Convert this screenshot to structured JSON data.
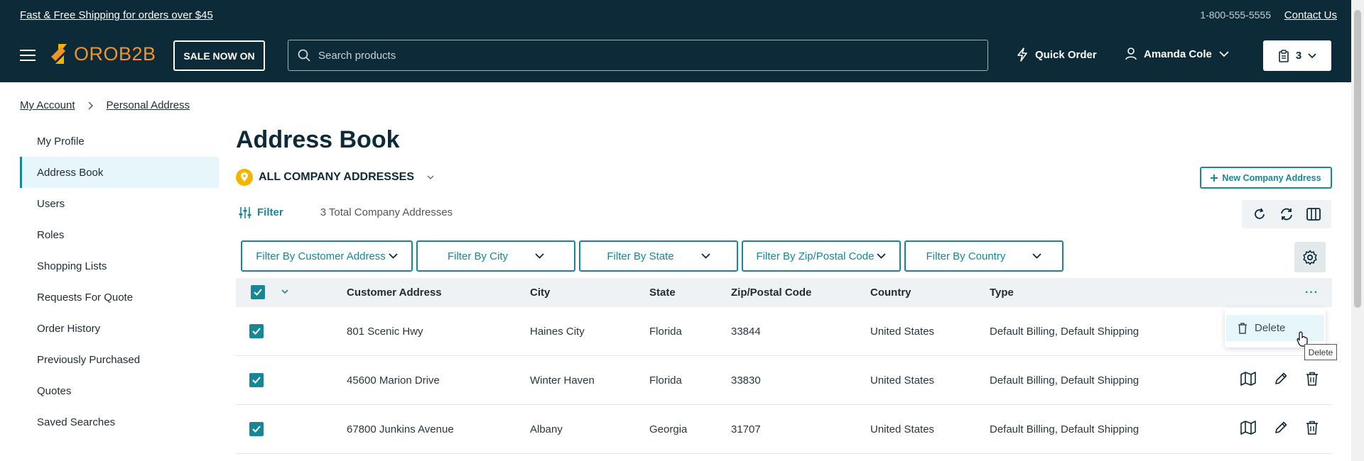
{
  "topbar": {
    "promo": "Fast & Free Shipping for orders over $45",
    "phone": "1-800-555-5555",
    "contact": "Contact Us"
  },
  "header": {
    "logo": "OROB2B",
    "sale_label": "SALE NOW ON",
    "search_placeholder": "Search products",
    "quick_order": "Quick Order",
    "user_name": "Amanda Cole",
    "cart_count": "3"
  },
  "breadcrumb": [
    "My Account",
    "Personal Address"
  ],
  "sidebar": {
    "items": [
      {
        "label": "My Profile"
      },
      {
        "label": "Address Book"
      },
      {
        "label": "Users"
      },
      {
        "label": "Roles"
      },
      {
        "label": "Shopping Lists"
      },
      {
        "label": "Requests For Quote"
      },
      {
        "label": "Order History"
      },
      {
        "label": "Previously Purchased"
      },
      {
        "label": "Quotes"
      },
      {
        "label": "Saved Searches"
      }
    ],
    "active": "Address Book"
  },
  "main": {
    "title": "Address Book",
    "address_selector": "ALL COMPANY ADDRESSES",
    "new_address_button": "New Company Address",
    "filter_label": "Filter",
    "total_label": "3 Total Company Addresses",
    "filters": [
      "Filter By Customer Address",
      "Filter By City",
      "Filter By State",
      "Filter By Zip/Postal Code",
      "Filter By Country"
    ],
    "columns": [
      "Customer Address",
      "City",
      "State",
      "Zip/Postal Code",
      "Country",
      "Type"
    ],
    "rows": [
      {
        "address": "801 Scenic Hwy",
        "city": "Haines City",
        "state": "Florida",
        "zip": "33844",
        "country": "United States",
        "type": "Default Billing, Default Shipping"
      },
      {
        "address": "45600 Marion Drive",
        "city": "Winter Haven",
        "state": "Florida",
        "zip": "33830",
        "country": "United States",
        "type": "Default Billing, Default Shipping"
      },
      {
        "address": "67800 Junkins Avenue",
        "city": "Albany",
        "state": "Georgia",
        "zip": "31707",
        "country": "United States",
        "type": "Default Billing, Default Shipping"
      }
    ],
    "mass_action": {
      "label": "Delete",
      "tooltip": "Delete"
    }
  },
  "colors": {
    "header_bg": "#0c2a37",
    "accent": "#178796",
    "logo": "#f0932b",
    "active_bg": "#e6f6fb"
  }
}
